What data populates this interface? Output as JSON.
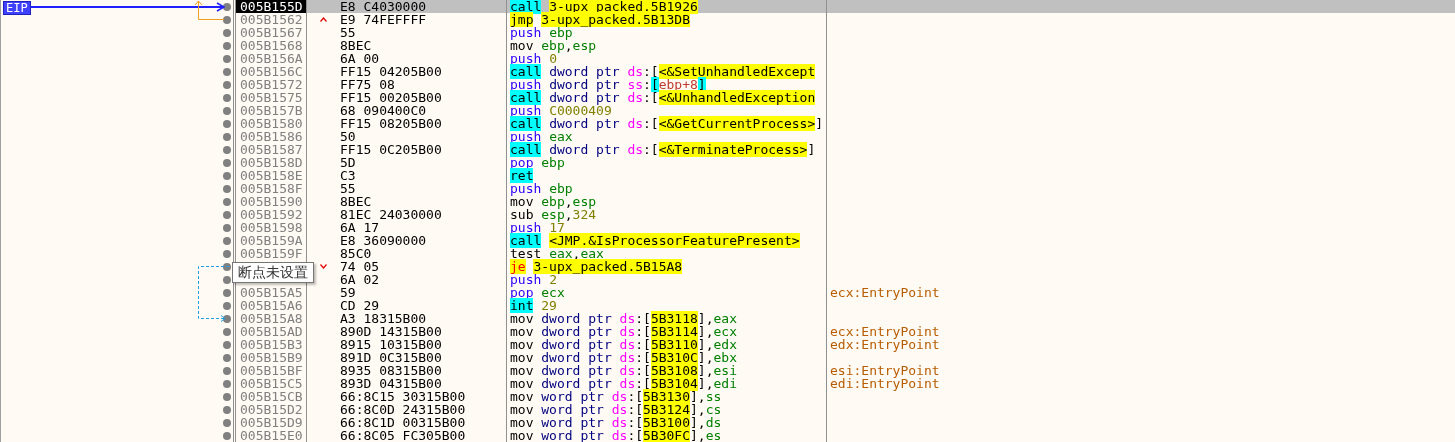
{
  "eip_label": "EIP",
  "rows": [
    {
      "address": "005B155D",
      "bytes": "E8 C4030000",
      "current": true,
      "selected": true,
      "instruction": [
        {
          "text": "call",
          "kind": "call"
        },
        {
          "text": "3-upx_packed.5B1926",
          "kind": "label",
          "gap_before": true
        }
      ]
    },
    {
      "address": "005B1562",
      "bytes": "E9 74FEFFFF",
      "jump_up": true,
      "current": false,
      "selected": false,
      "instruction": [
        {
          "text": "jmp",
          "kind": "jmp"
        },
        {
          "text": "3-upx_packed.5B13DB",
          "kind": "label",
          "gap_before": true
        }
      ]
    },
    {
      "address": "005B1567",
      "bytes": "55",
      "current": false,
      "selected": false,
      "instruction": [
        {
          "text": "push",
          "kind": "stack"
        },
        {
          "text": "ebp",
          "kind": "reg",
          "gap_before": true
        }
      ]
    },
    {
      "address": "005B1568",
      "bytes": "8BEC",
      "current": false,
      "selected": false,
      "instruction": [
        {
          "text": "mov",
          "kind": "op"
        },
        {
          "text": "ebp",
          "kind": "reg",
          "gap_before": true
        },
        {
          "text": ",",
          "kind": "punct"
        },
        {
          "text": "esp",
          "kind": "reg"
        }
      ]
    },
    {
      "address": "005B156A",
      "bytes": "6A 00",
      "current": false,
      "selected": false,
      "instruction": [
        {
          "text": "push",
          "kind": "stack"
        },
        {
          "text": "0",
          "kind": "num",
          "gap_before": true
        }
      ]
    },
    {
      "address": "005B156C",
      "bytes": "FF15 04205B00",
      "current": false,
      "selected": false,
      "instruction": [
        {
          "text": "call",
          "kind": "call"
        },
        {
          "text": "dword ptr",
          "kind": "size",
          "gap_before": true
        },
        {
          "text": "ds",
          "kind": "seg",
          "gap_before": true
        },
        {
          "text": ":[",
          "kind": "punct"
        },
        {
          "text": "<&SetUnhandledExcept",
          "kind": "label"
        }
      ]
    },
    {
      "address": "005B1572",
      "bytes": "FF75 08",
      "current": false,
      "selected": false,
      "instruction": [
        {
          "text": "push",
          "kind": "stack"
        },
        {
          "text": "dword ptr",
          "kind": "size",
          "gap_before": true
        },
        {
          "text": "ss",
          "kind": "seg",
          "gap_before": true
        },
        {
          "text": ":",
          "kind": "punct"
        },
        {
          "text": "[",
          "kind": "bracket"
        },
        {
          "text": "ebp+8",
          "kind": "mem"
        },
        {
          "text": "]",
          "kind": "bracket"
        }
      ]
    },
    {
      "address": "005B1575",
      "bytes": "FF15 00205B00",
      "current": false,
      "selected": false,
      "instruction": [
        {
          "text": "call",
          "kind": "call"
        },
        {
          "text": "dword ptr",
          "kind": "size",
          "gap_before": true
        },
        {
          "text": "ds",
          "kind": "seg",
          "gap_before": true
        },
        {
          "text": ":[",
          "kind": "punct"
        },
        {
          "text": "<&UnhandledException",
          "kind": "label"
        }
      ]
    },
    {
      "address": "005B157B",
      "bytes": "68 090400C0",
      "current": false,
      "selected": false,
      "instruction": [
        {
          "text": "push",
          "kind": "stack"
        },
        {
          "text": "C0000409",
          "kind": "num",
          "gap_before": true
        }
      ]
    },
    {
      "address": "005B1580",
      "bytes": "FF15 08205B00",
      "current": false,
      "selected": false,
      "instruction": [
        {
          "text": "call",
          "kind": "call"
        },
        {
          "text": "dword ptr",
          "kind": "size",
          "gap_before": true
        },
        {
          "text": "ds",
          "kind": "seg",
          "gap_before": true
        },
        {
          "text": ":[",
          "kind": "punct"
        },
        {
          "text": "<&GetCurrentProcess>",
          "kind": "label"
        },
        {
          "text": "]",
          "kind": "punct"
        }
      ]
    },
    {
      "address": "005B1586",
      "bytes": "50",
      "current": false,
      "selected": false,
      "instruction": [
        {
          "text": "push",
          "kind": "stack"
        },
        {
          "text": "eax",
          "kind": "reg",
          "gap_before": true
        }
      ]
    },
    {
      "address": "005B1587",
      "bytes": "FF15 0C205B00",
      "current": false,
      "selected": false,
      "instruction": [
        {
          "text": "call",
          "kind": "call"
        },
        {
          "text": "dword ptr",
          "kind": "size",
          "gap_before": true
        },
        {
          "text": "ds",
          "kind": "seg",
          "gap_before": true
        },
        {
          "text": ":[",
          "kind": "punct"
        },
        {
          "text": "<&TerminateProcess>",
          "kind": "label"
        },
        {
          "text": "]",
          "kind": "punct"
        }
      ]
    },
    {
      "address": "005B158D",
      "bytes": "5D",
      "current": false,
      "selected": false,
      "instruction": [
        {
          "text": "pop",
          "kind": "stack"
        },
        {
          "text": "ebp",
          "kind": "reg",
          "gap_before": true
        }
      ]
    },
    {
      "address": "005B158E",
      "bytes": "C3",
      "current": false,
      "selected": false,
      "instruction": [
        {
          "text": "ret",
          "kind": "call"
        }
      ]
    },
    {
      "address": "005B158F",
      "bytes": "55",
      "current": false,
      "selected": false,
      "instruction": [
        {
          "text": "push",
          "kind": "stack"
        },
        {
          "text": "ebp",
          "kind": "reg",
          "gap_before": true
        }
      ]
    },
    {
      "address": "005B1590",
      "bytes": "8BEC",
      "current": false,
      "selected": false,
      "instruction": [
        {
          "text": "mov",
          "kind": "op"
        },
        {
          "text": "ebp",
          "kind": "reg",
          "gap_before": true
        },
        {
          "text": ",",
          "kind": "punct"
        },
        {
          "text": "esp",
          "kind": "reg"
        }
      ]
    },
    {
      "address": "005B1592",
      "bytes": "81EC 24030000",
      "current": false,
      "selected": false,
      "instruction": [
        {
          "text": "sub",
          "kind": "op"
        },
        {
          "text": "esp",
          "kind": "reg",
          "gap_before": true
        },
        {
          "text": ",",
          "kind": "punct"
        },
        {
          "text": "324",
          "kind": "num"
        }
      ]
    },
    {
      "address": "005B1598",
      "bytes": "6A 17",
      "current": false,
      "selected": false,
      "instruction": [
        {
          "text": "push",
          "kind": "stack"
        },
        {
          "text": "17",
          "kind": "num",
          "gap_before": true
        }
      ]
    },
    {
      "address": "005B159A",
      "bytes": "E8 36090000",
      "current": false,
      "selected": false,
      "instruction": [
        {
          "text": "call",
          "kind": "call"
        },
        {
          "text": "<JMP.&IsProcessorFeaturePresent>",
          "kind": "label",
          "gap_before": true
        }
      ]
    },
    {
      "address": "005B159F",
      "bytes": "85C0",
      "current": false,
      "selected": false,
      "instruction": [
        {
          "text": "test",
          "kind": "op"
        },
        {
          "text": "eax",
          "kind": "reg",
          "gap_before": true
        },
        {
          "text": ",",
          "kind": "punct"
        },
        {
          "text": "eax",
          "kind": "reg"
        }
      ]
    },
    {
      "bytes": "74 05",
      "jump_down": true,
      "current": false,
      "selected": false,
      "instruction": [
        {
          "text": "je",
          "kind": "jcc"
        },
        {
          "text": "3-upx_packed.5B15A8",
          "kind": "label",
          "gap_before": true
        }
      ]
    },
    {
      "bytes": "6A 02",
      "current": false,
      "selected": false,
      "instruction": [
        {
          "text": "push",
          "kind": "stack"
        },
        {
          "text": "2",
          "kind": "num",
          "gap_before": true
        }
      ]
    },
    {
      "address": "005B15A5",
      "bytes": "59",
      "current": false,
      "selected": false,
      "comment": "ecx:EntryPoint",
      "instruction": [
        {
          "text": "pop",
          "kind": "stack"
        },
        {
          "text": "ecx",
          "kind": "reg",
          "gap_before": true
        }
      ]
    },
    {
      "address": "005B15A6",
      "bytes": "CD 29",
      "current": false,
      "selected": false,
      "instruction": [
        {
          "text": "int",
          "kind": "call"
        },
        {
          "text": "29",
          "kind": "num",
          "gap_before": true
        }
      ]
    },
    {
      "address": "005B15A8",
      "bytes": "A3 18315B00",
      "current": false,
      "selected": false,
      "instruction": [
        {
          "text": "mov",
          "kind": "op"
        },
        {
          "text": "dword ptr",
          "kind": "size",
          "gap_before": true
        },
        {
          "text": "ds",
          "kind": "seg",
          "gap_before": true
        },
        {
          "text": ":[",
          "kind": "punct"
        },
        {
          "text": "5B3118",
          "kind": "label"
        },
        {
          "text": "],",
          "kind": "punct"
        },
        {
          "text": "eax",
          "kind": "reg"
        }
      ]
    },
    {
      "address": "005B15AD",
      "bytes": "890D 14315B00",
      "current": false,
      "selected": false,
      "comment": "ecx:EntryPoint",
      "instruction": [
        {
          "text": "mov",
          "kind": "op"
        },
        {
          "text": "dword ptr",
          "kind": "size",
          "gap_before": true
        },
        {
          "text": "ds",
          "kind": "seg",
          "gap_before": true
        },
        {
          "text": ":[",
          "kind": "punct"
        },
        {
          "text": "5B3114",
          "kind": "label"
        },
        {
          "text": "],",
          "kind": "punct"
        },
        {
          "text": "ecx",
          "kind": "reg"
        }
      ]
    },
    {
      "address": "005B15B3",
      "bytes": "8915 10315B00",
      "current": false,
      "selected": false,
      "comment": "edx:EntryPoint",
      "instruction": [
        {
          "text": "mov",
          "kind": "op"
        },
        {
          "text": "dword ptr",
          "kind": "size",
          "gap_before": true
        },
        {
          "text": "ds",
          "kind": "seg",
          "gap_before": true
        },
        {
          "text": ":[",
          "kind": "punct"
        },
        {
          "text": "5B3110",
          "kind": "label"
        },
        {
          "text": "],",
          "kind": "punct"
        },
        {
          "text": "edx",
          "kind": "reg"
        }
      ]
    },
    {
      "address": "005B15B9",
      "bytes": "891D 0C315B00",
      "current": false,
      "selected": false,
      "instruction": [
        {
          "text": "mov",
          "kind": "op"
        },
        {
          "text": "dword ptr",
          "kind": "size",
          "gap_before": true
        },
        {
          "text": "ds",
          "kind": "seg",
          "gap_before": true
        },
        {
          "text": ":[",
          "kind": "punct"
        },
        {
          "text": "5B310C",
          "kind": "label"
        },
        {
          "text": "],",
          "kind": "punct"
        },
        {
          "text": "ebx",
          "kind": "reg"
        }
      ]
    },
    {
      "address": "005B15BF",
      "bytes": "8935 08315B00",
      "current": false,
      "selected": false,
      "comment": "esi:EntryPoint",
      "instruction": [
        {
          "text": "mov",
          "kind": "op"
        },
        {
          "text": "dword ptr",
          "kind": "size",
          "gap_before": true
        },
        {
          "text": "ds",
          "kind": "seg",
          "gap_before": true
        },
        {
          "text": ":[",
          "kind": "punct"
        },
        {
          "text": "5B3108",
          "kind": "label"
        },
        {
          "text": "],",
          "kind": "punct"
        },
        {
          "text": "esi",
          "kind": "reg"
        }
      ]
    },
    {
      "address": "005B15C5",
      "bytes": "893D 04315B00",
      "current": false,
      "selected": false,
      "comment": "edi:EntryPoint",
      "instruction": [
        {
          "text": "mov",
          "kind": "op"
        },
        {
          "text": "dword ptr",
          "kind": "size",
          "gap_before": true
        },
        {
          "text": "ds",
          "kind": "seg",
          "gap_before": true
        },
        {
          "text": ":[",
          "kind": "punct"
        },
        {
          "text": "5B3104",
          "kind": "label"
        },
        {
          "text": "],",
          "kind": "punct"
        },
        {
          "text": "edi",
          "kind": "reg"
        }
      ]
    },
    {
      "address": "005B15CB",
      "bytes": "66:8C15 30315B00",
      "current": false,
      "selected": false,
      "instruction": [
        {
          "text": "mov",
          "kind": "op"
        },
        {
          "text": "word ptr",
          "kind": "size",
          "gap_before": true
        },
        {
          "text": "ds",
          "kind": "seg",
          "gap_before": true
        },
        {
          "text": ":[",
          "kind": "punct"
        },
        {
          "text": "5B3130",
          "kind": "label"
        },
        {
          "text": "],",
          "kind": "punct"
        },
        {
          "text": "ss",
          "kind": "reg"
        }
      ]
    },
    {
      "address": "005B15D2",
      "bytes": "66:8C0D 24315B00",
      "current": false,
      "selected": false,
      "instruction": [
        {
          "text": "mov",
          "kind": "op"
        },
        {
          "text": "word ptr",
          "kind": "size",
          "gap_before": true
        },
        {
          "text": "ds",
          "kind": "seg",
          "gap_before": true
        },
        {
          "text": ":[",
          "kind": "punct"
        },
        {
          "text": "5B3124",
          "kind": "label"
        },
        {
          "text": "],",
          "kind": "punct"
        },
        {
          "text": "cs",
          "kind": "reg"
        }
      ]
    },
    {
      "address": "005B15D9",
      "bytes": "66:8C1D 00315B00",
      "current": false,
      "selected": false,
      "instruction": [
        {
          "text": "mov",
          "kind": "op"
        },
        {
          "text": "word ptr",
          "kind": "size",
          "gap_before": true
        },
        {
          "text": "ds",
          "kind": "seg",
          "gap_before": true
        },
        {
          "text": ":[",
          "kind": "punct"
        },
        {
          "text": "5B3100",
          "kind": "label"
        },
        {
          "text": "],",
          "kind": "punct"
        },
        {
          "text": "ds",
          "kind": "reg"
        }
      ]
    },
    {
      "address": "005B15E0",
      "bytes": "66:8C05 FC305B00",
      "current": false,
      "selected": false,
      "instruction": [
        {
          "text": "mov",
          "kind": "op"
        },
        {
          "text": "word ptr",
          "kind": "size",
          "gap_before": true
        },
        {
          "text": "ds",
          "kind": "seg",
          "gap_before": true
        },
        {
          "text": ":[",
          "kind": "punct"
        },
        {
          "text": "5B30FC",
          "kind": "label"
        },
        {
          "text": "],",
          "kind": "punct"
        },
        {
          "text": "es",
          "kind": "reg"
        }
      ]
    }
  ],
  "tooltip": "断点未设置"
}
